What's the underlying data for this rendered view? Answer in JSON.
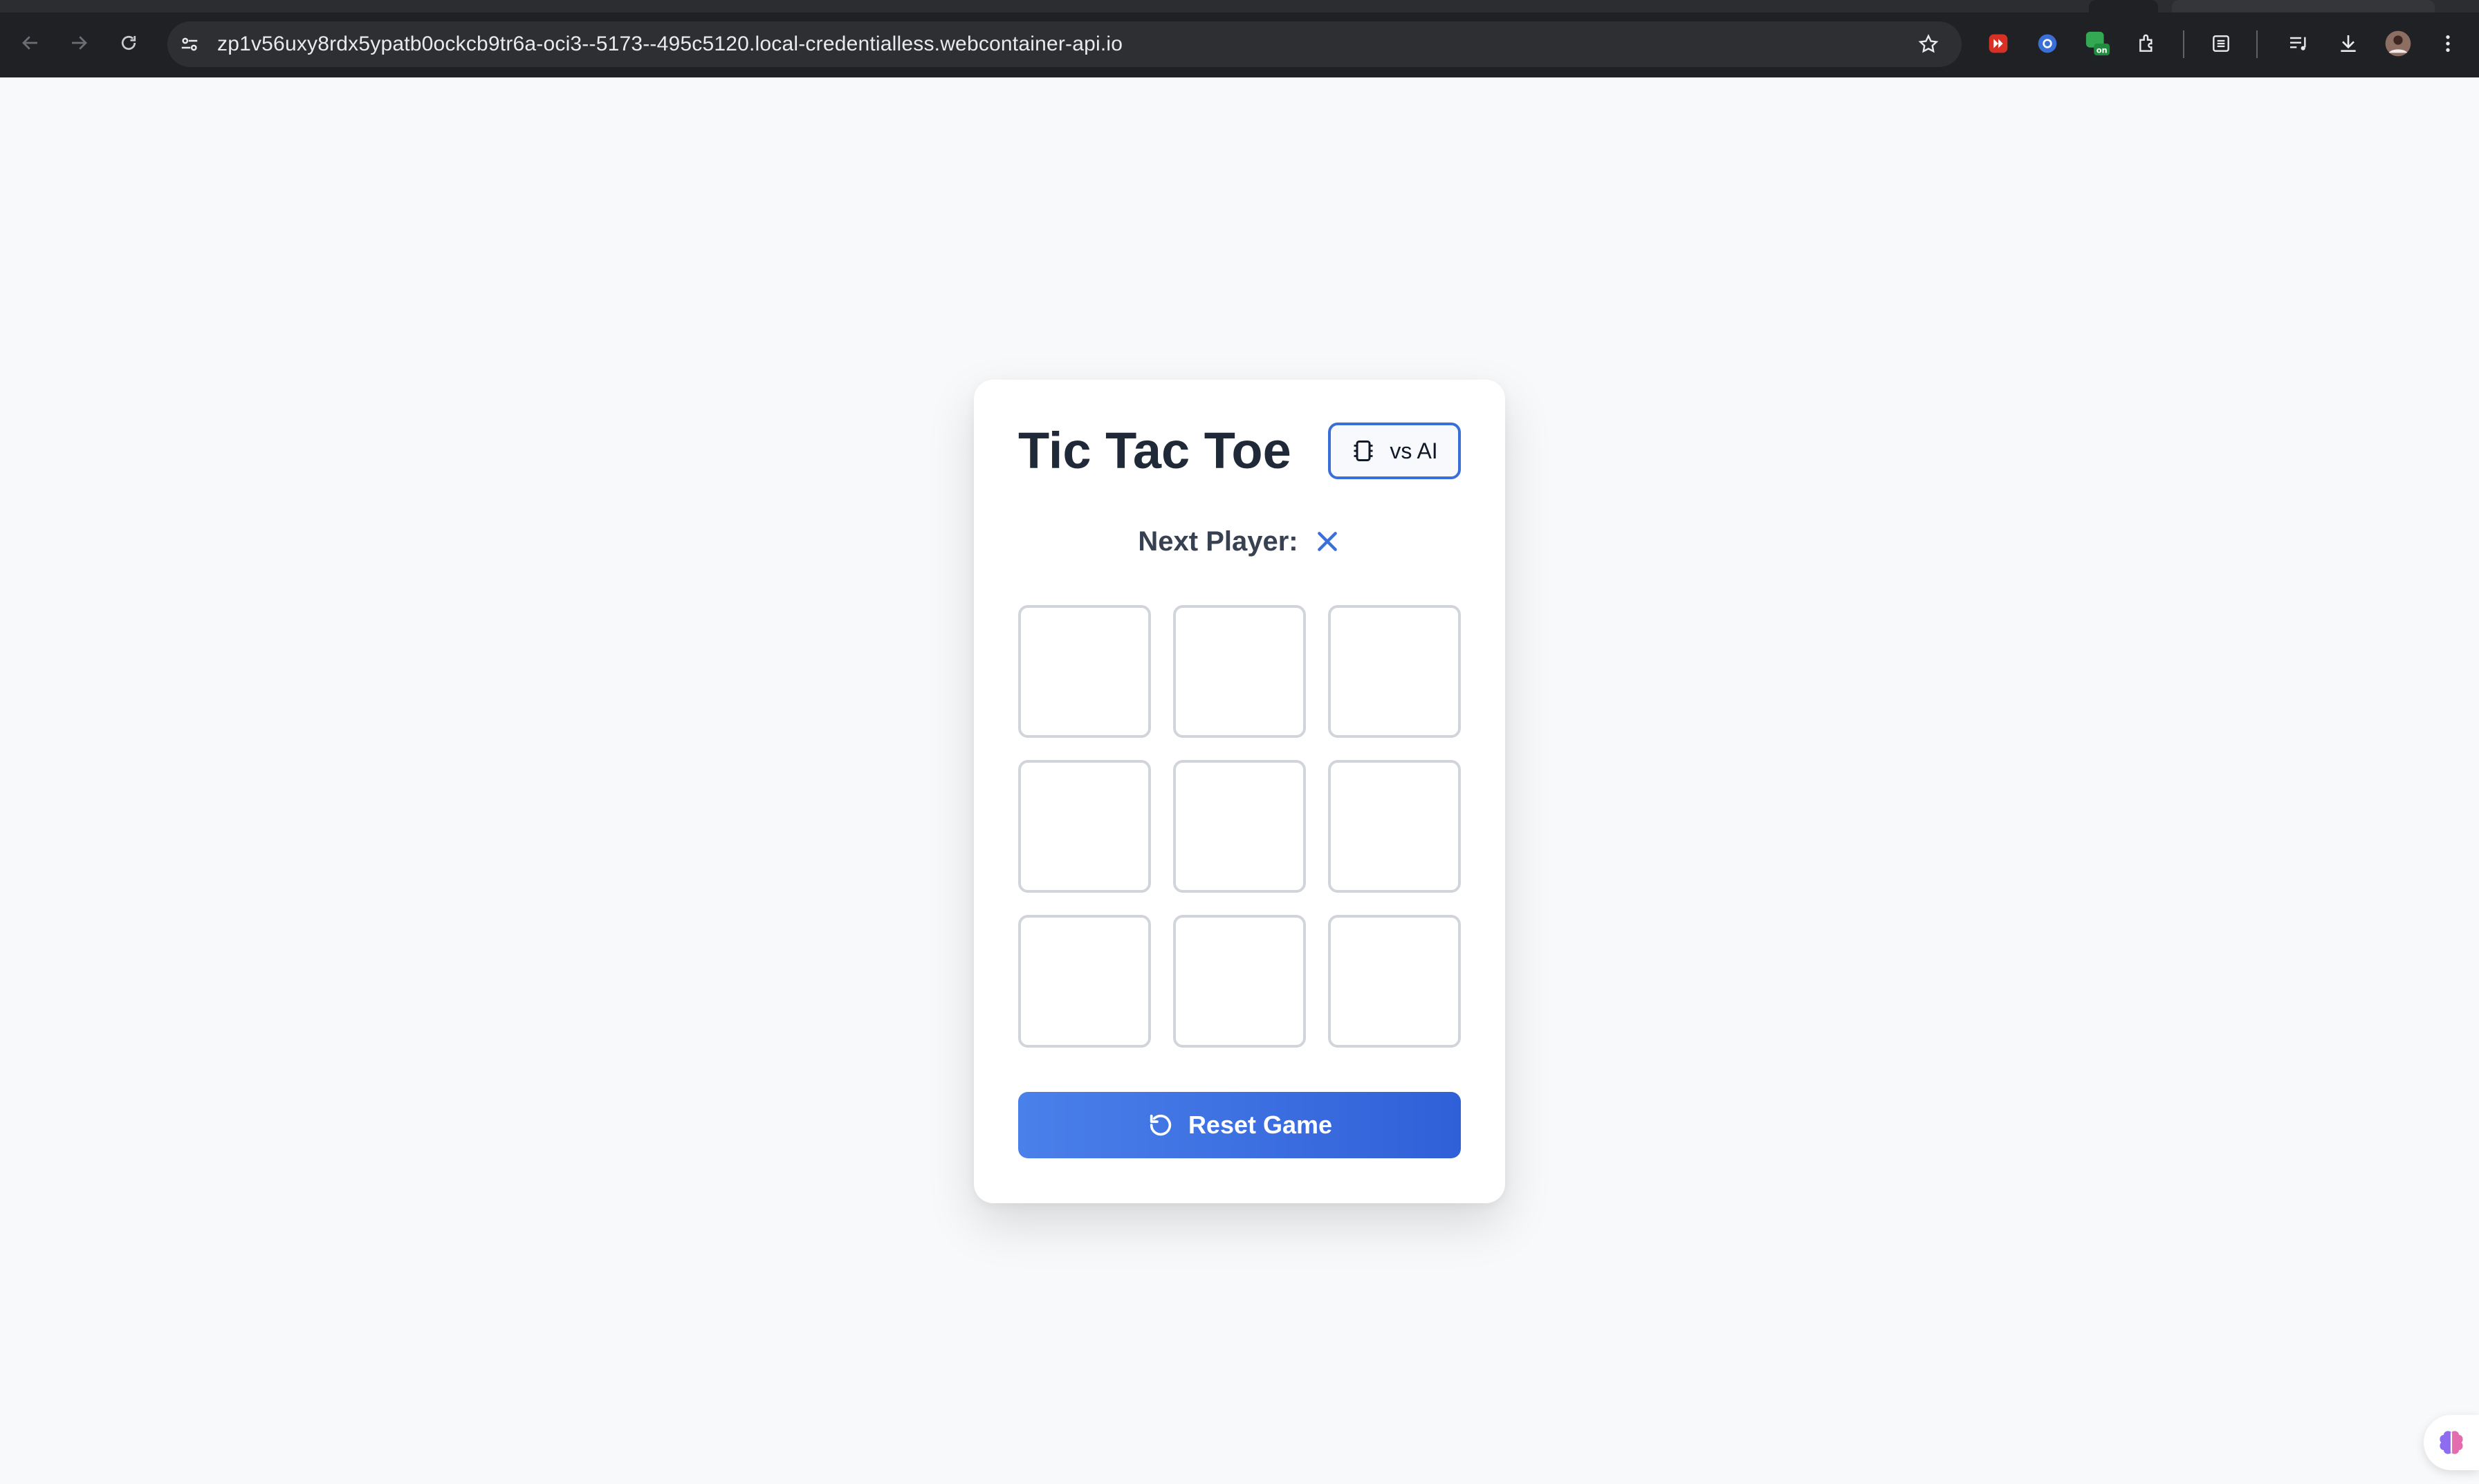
{
  "browser": {
    "url": "zp1v56uxy8rdx5ypatb0ockcb9tr6a-oci3--5173--495c5120.local-credentialless.webcontainer-api.io",
    "extension_badge": "on",
    "icons": [
      "back-icon",
      "forward-icon",
      "reload-icon",
      "site-info-icon",
      "bookmark-star-icon",
      "extension-icon",
      "reading-list-icon",
      "media-icon",
      "download-icon",
      "profile-avatar",
      "more-menu-icon"
    ]
  },
  "game": {
    "title": "Tic Tac Toe",
    "mode_label": "vs AI",
    "status_label": "Next Player:",
    "next_player": "X",
    "board": [
      "",
      "",
      "",
      "",
      "",
      "",
      "",
      "",
      ""
    ],
    "reset_label": "Reset Game"
  },
  "colors": {
    "accent": "#3b6fd8",
    "page_background": "#f8f9fa",
    "title_text": "#1f2937",
    "cell_border": "#d1d5db"
  }
}
